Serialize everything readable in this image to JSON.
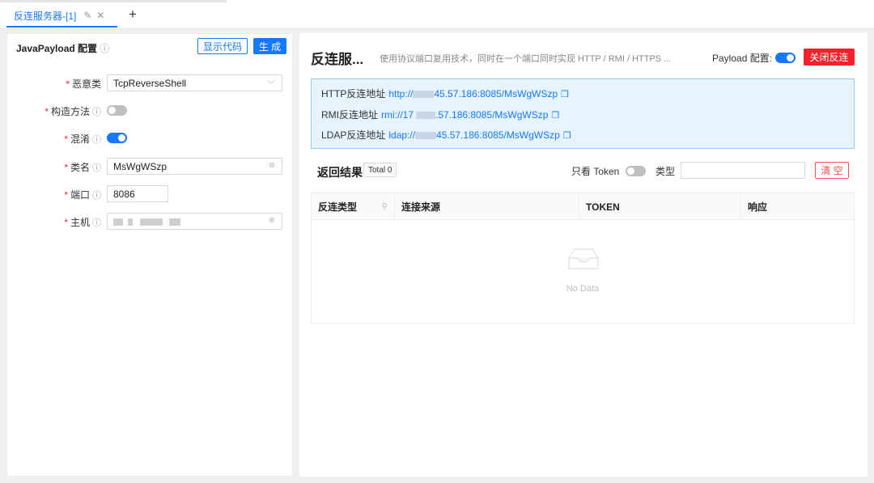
{
  "tabs": [
    {
      "label": "反连服务器-[1]",
      "edit_icon": "✎",
      "close_icon": "✕"
    }
  ],
  "add_tab_label": "+",
  "left_panel": {
    "title": "JavaPayload 配置",
    "info_icon": "ⓘ",
    "show_code_button": "显示代码",
    "generate_button": "生 成",
    "fields": {
      "malicious_class": {
        "label": "恶意类",
        "value": "TcpReverseShell",
        "suffix": "﹀"
      },
      "construct_method": {
        "label": "构造方法",
        "on": false
      },
      "obfuscate": {
        "label": "混淆",
        "on": true
      },
      "class_name": {
        "label": "类名",
        "value": "MsWgWSzp",
        "suffix": "⊗"
      },
      "port": {
        "label": "端口",
        "value": "8086"
      },
      "host": {
        "label": "主机",
        "suffix": "⊗"
      }
    },
    "required_mark": "*"
  },
  "right_panel": {
    "title": "反连服...",
    "description": "使用协议端口复用技术，同时在一个端口同时实现 HTTP / RMI / HTTPS ...",
    "payload_config_label": "Payload 配置:",
    "payload_config_on": true,
    "close_reverse_button": "关闭反连",
    "addresses": [
      {
        "label": "HTTP反连地址",
        "prefix": "http://",
        "suffix": "45.57.186:8085/MsWgWSzp"
      },
      {
        "label": "RMI反连地址",
        "prefix": "rmi://17",
        "suffix": ".57.186:8085/MsWgWSzp"
      },
      {
        "label": "LDAP反连地址",
        "prefix": "ldap://",
        "suffix": "45.57.186:8085/MsWgWSzp"
      }
    ],
    "copy_icon": "❐",
    "results_title": "返回结果",
    "total_badge": "Total 0",
    "token_only_label": "只看 Token",
    "token_only_on": false,
    "type_label": "类型",
    "clear_button": "清 空",
    "table": {
      "columns": [
        "反连类型",
        "连接来源",
        "TOKEN",
        "响应"
      ],
      "filter_icon": "🔍",
      "empty_text": "No Data"
    }
  }
}
